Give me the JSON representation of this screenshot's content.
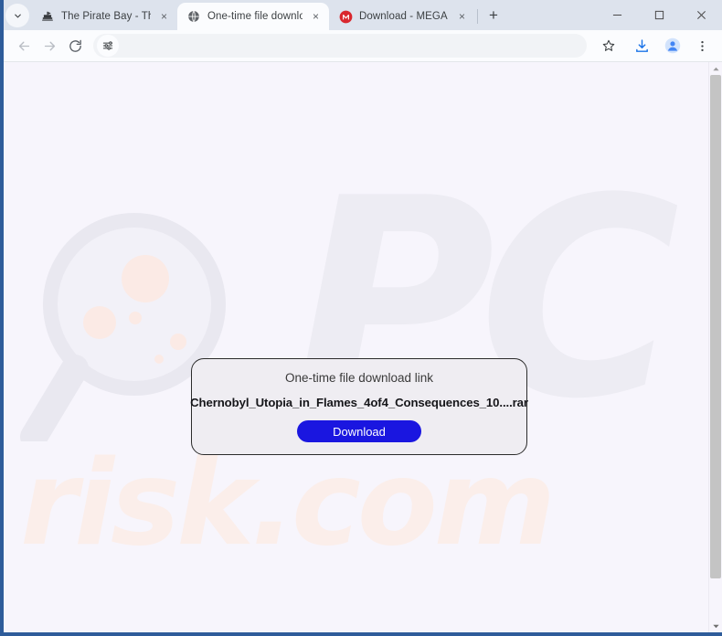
{
  "browser": {
    "tab_search_icon": "chevron-down-icon",
    "tabs": [
      {
        "title": "The Pirate Bay - The galaxy's m",
        "favicon": "pirate-ship-icon",
        "active": false,
        "close_label": "×"
      },
      {
        "title": "One-time file download link",
        "favicon": "globe-icon",
        "active": true,
        "close_label": "×"
      },
      {
        "title": "Download - MEGA",
        "favicon": "mega-logo-icon",
        "active": false,
        "close_label": "×"
      }
    ],
    "new_tab_label": "+",
    "window_controls": {
      "minimize": "–",
      "maximize": "□",
      "close": "✕"
    },
    "toolbar": {
      "back_icon": "arrow-left-icon",
      "forward_icon": "arrow-right-icon",
      "reload_icon": "reload-icon",
      "tune_icon": "tune-sliders-icon",
      "address_value": "",
      "address_placeholder": "",
      "bookmark_icon": "star-outline-icon",
      "downloads_icon": "download-tray-icon",
      "profile_icon": "profile-avatar-icon",
      "menu_icon": "three-dot-menu-icon"
    }
  },
  "page": {
    "watermark_brand": "PC",
    "watermark_domain": "risk.com",
    "dialog": {
      "heading": "One-time file download link",
      "filename": "Chernobyl_Utopia_in_Flames_4of4_Consequences_10....rar",
      "download_button": "Download"
    },
    "scrollbar": {
      "up_arrow": "▲",
      "down_arrow": "▼"
    }
  },
  "colors": {
    "window_frame": "#2e5c9a",
    "tabstrip_bg": "#dde3ed",
    "active_tab_bg": "#fbfcfe",
    "page_bg": "#f7f5fc",
    "dialog_bg": "#efedf2",
    "dialog_border": "#2b2b2b",
    "download_button": "#1a16e0",
    "watermark_gray": "#edecf3",
    "watermark_pink": "#fbeeea",
    "accent_blue": "#1a73e8",
    "mega_red": "#d9272e"
  }
}
